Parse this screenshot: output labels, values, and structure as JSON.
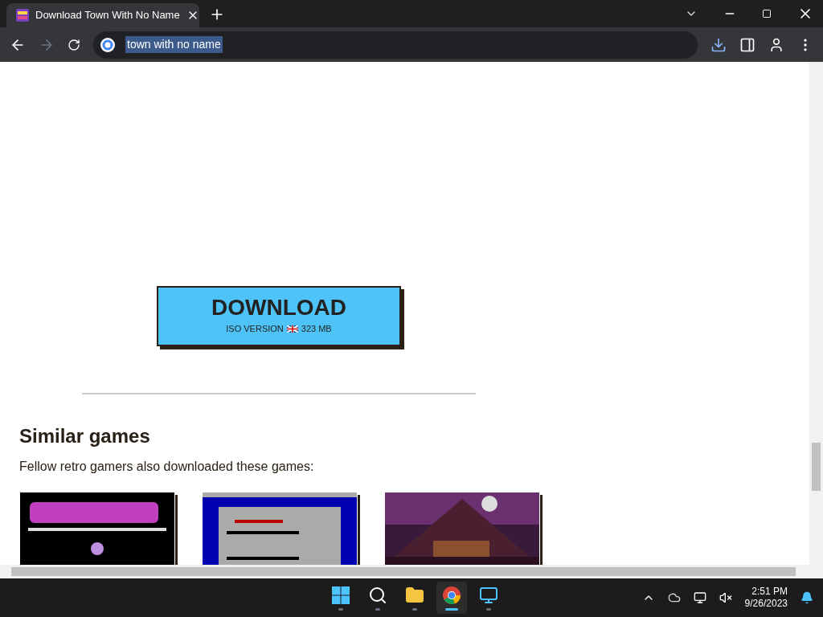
{
  "browser": {
    "tabs": [
      {
        "title": "Download Town With No Name",
        "selected": true
      }
    ],
    "address": "town with no name"
  },
  "download_button": {
    "label": "DOWNLOAD",
    "detail_before": "ISO VERSION",
    "detail_after": "323 MB"
  },
  "similar": {
    "heading": "Similar games",
    "subtitle": "Fellow retro gamers also downloaded these games:"
  },
  "taskbar": {
    "apps": [
      {
        "kind": "start",
        "selected": false
      },
      {
        "kind": "search",
        "selected": false
      },
      {
        "kind": "files",
        "selected": false
      },
      {
        "kind": "chrome",
        "selected": true
      },
      {
        "kind": "remote",
        "selected": false
      }
    ],
    "time": "2:51 PM",
    "date": "9/26/2023"
  }
}
